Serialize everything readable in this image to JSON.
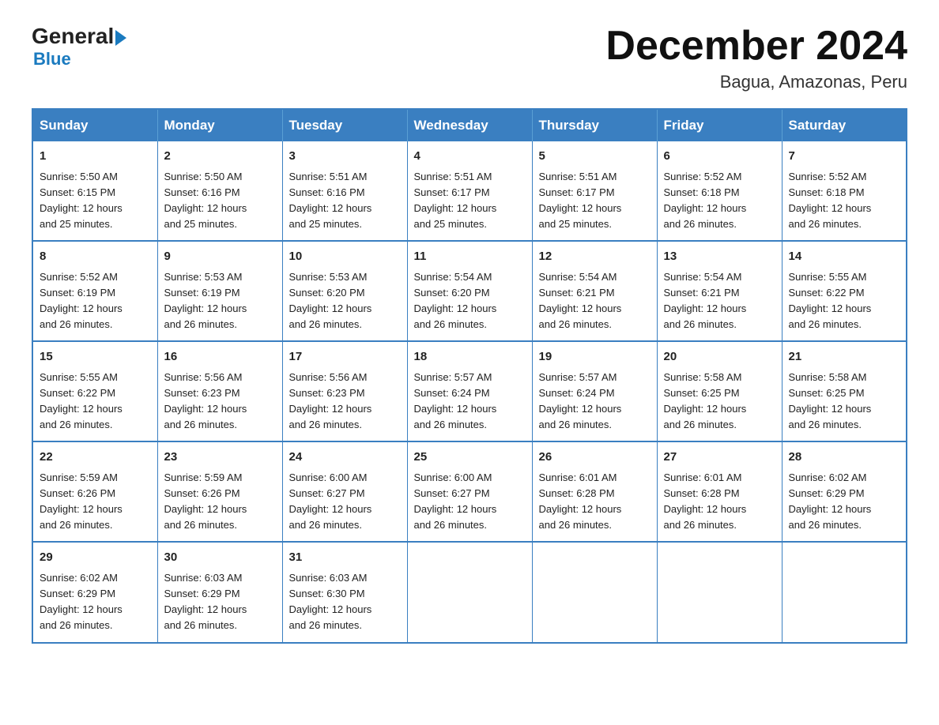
{
  "header": {
    "logo_general": "General",
    "logo_blue": "Blue",
    "month_title": "December 2024",
    "location": "Bagua, Amazonas, Peru"
  },
  "calendar": {
    "days_of_week": [
      "Sunday",
      "Monday",
      "Tuesday",
      "Wednesday",
      "Thursday",
      "Friday",
      "Saturday"
    ],
    "weeks": [
      [
        {
          "day": "1",
          "sunrise": "5:50 AM",
          "sunset": "6:15 PM",
          "daylight": "12 hours and 25 minutes."
        },
        {
          "day": "2",
          "sunrise": "5:50 AM",
          "sunset": "6:16 PM",
          "daylight": "12 hours and 25 minutes."
        },
        {
          "day": "3",
          "sunrise": "5:51 AM",
          "sunset": "6:16 PM",
          "daylight": "12 hours and 25 minutes."
        },
        {
          "day": "4",
          "sunrise": "5:51 AM",
          "sunset": "6:17 PM",
          "daylight": "12 hours and 25 minutes."
        },
        {
          "day": "5",
          "sunrise": "5:51 AM",
          "sunset": "6:17 PM",
          "daylight": "12 hours and 25 minutes."
        },
        {
          "day": "6",
          "sunrise": "5:52 AM",
          "sunset": "6:18 PM",
          "daylight": "12 hours and 26 minutes."
        },
        {
          "day": "7",
          "sunrise": "5:52 AM",
          "sunset": "6:18 PM",
          "daylight": "12 hours and 26 minutes."
        }
      ],
      [
        {
          "day": "8",
          "sunrise": "5:52 AM",
          "sunset": "6:19 PM",
          "daylight": "12 hours and 26 minutes."
        },
        {
          "day": "9",
          "sunrise": "5:53 AM",
          "sunset": "6:19 PM",
          "daylight": "12 hours and 26 minutes."
        },
        {
          "day": "10",
          "sunrise": "5:53 AM",
          "sunset": "6:20 PM",
          "daylight": "12 hours and 26 minutes."
        },
        {
          "day": "11",
          "sunrise": "5:54 AM",
          "sunset": "6:20 PM",
          "daylight": "12 hours and 26 minutes."
        },
        {
          "day": "12",
          "sunrise": "5:54 AM",
          "sunset": "6:21 PM",
          "daylight": "12 hours and 26 minutes."
        },
        {
          "day": "13",
          "sunrise": "5:54 AM",
          "sunset": "6:21 PM",
          "daylight": "12 hours and 26 minutes."
        },
        {
          "day": "14",
          "sunrise": "5:55 AM",
          "sunset": "6:22 PM",
          "daylight": "12 hours and 26 minutes."
        }
      ],
      [
        {
          "day": "15",
          "sunrise": "5:55 AM",
          "sunset": "6:22 PM",
          "daylight": "12 hours and 26 minutes."
        },
        {
          "day": "16",
          "sunrise": "5:56 AM",
          "sunset": "6:23 PM",
          "daylight": "12 hours and 26 minutes."
        },
        {
          "day": "17",
          "sunrise": "5:56 AM",
          "sunset": "6:23 PM",
          "daylight": "12 hours and 26 minutes."
        },
        {
          "day": "18",
          "sunrise": "5:57 AM",
          "sunset": "6:24 PM",
          "daylight": "12 hours and 26 minutes."
        },
        {
          "day": "19",
          "sunrise": "5:57 AM",
          "sunset": "6:24 PM",
          "daylight": "12 hours and 26 minutes."
        },
        {
          "day": "20",
          "sunrise": "5:58 AM",
          "sunset": "6:25 PM",
          "daylight": "12 hours and 26 minutes."
        },
        {
          "day": "21",
          "sunrise": "5:58 AM",
          "sunset": "6:25 PM",
          "daylight": "12 hours and 26 minutes."
        }
      ],
      [
        {
          "day": "22",
          "sunrise": "5:59 AM",
          "sunset": "6:26 PM",
          "daylight": "12 hours and 26 minutes."
        },
        {
          "day": "23",
          "sunrise": "5:59 AM",
          "sunset": "6:26 PM",
          "daylight": "12 hours and 26 minutes."
        },
        {
          "day": "24",
          "sunrise": "6:00 AM",
          "sunset": "6:27 PM",
          "daylight": "12 hours and 26 minutes."
        },
        {
          "day": "25",
          "sunrise": "6:00 AM",
          "sunset": "6:27 PM",
          "daylight": "12 hours and 26 minutes."
        },
        {
          "day": "26",
          "sunrise": "6:01 AM",
          "sunset": "6:28 PM",
          "daylight": "12 hours and 26 minutes."
        },
        {
          "day": "27",
          "sunrise": "6:01 AM",
          "sunset": "6:28 PM",
          "daylight": "12 hours and 26 minutes."
        },
        {
          "day": "28",
          "sunrise": "6:02 AM",
          "sunset": "6:29 PM",
          "daylight": "12 hours and 26 minutes."
        }
      ],
      [
        {
          "day": "29",
          "sunrise": "6:02 AM",
          "sunset": "6:29 PM",
          "daylight": "12 hours and 26 minutes."
        },
        {
          "day": "30",
          "sunrise": "6:03 AM",
          "sunset": "6:29 PM",
          "daylight": "12 hours and 26 minutes."
        },
        {
          "day": "31",
          "sunrise": "6:03 AM",
          "sunset": "6:30 PM",
          "daylight": "12 hours and 26 minutes."
        },
        null,
        null,
        null,
        null
      ]
    ],
    "labels": {
      "sunrise": "Sunrise:",
      "sunset": "Sunset:",
      "daylight": "Daylight:"
    }
  }
}
